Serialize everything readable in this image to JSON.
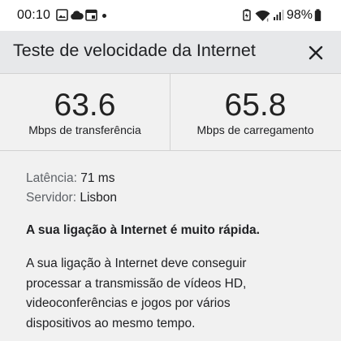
{
  "status_bar": {
    "time": "00:10",
    "battery": "98%",
    "icons": [
      "image-icon",
      "cloud-icon",
      "calendar-icon",
      "notification-dot-icon",
      "battery-saver-icon",
      "wifi-icon",
      "signal-icon",
      "battery-icon"
    ]
  },
  "header": {
    "title": "Teste de velocidade da Internet",
    "close_icon": "close-icon"
  },
  "metrics": {
    "download": {
      "value": "63.6",
      "label": "Mbps de transferência"
    },
    "upload": {
      "value": "65.8",
      "label": "Mbps de carregamento"
    }
  },
  "details": {
    "latency_label": "Latência:",
    "latency_value": "71 ms",
    "server_label": "Servidor:",
    "server_value": "Lisbon"
  },
  "summary": "A sua ligação à Internet é muito rápida.",
  "description": "A sua ligação à Internet deve conseguir processar a transmissão de vídeos HD, videoconferências e jogos por vários dispositivos ao mesmo tempo.",
  "colors": {
    "header_bg": "#e7e8ea",
    "page_bg": "#f1f1f1",
    "text": "#202124",
    "muted": "#5f6368"
  }
}
